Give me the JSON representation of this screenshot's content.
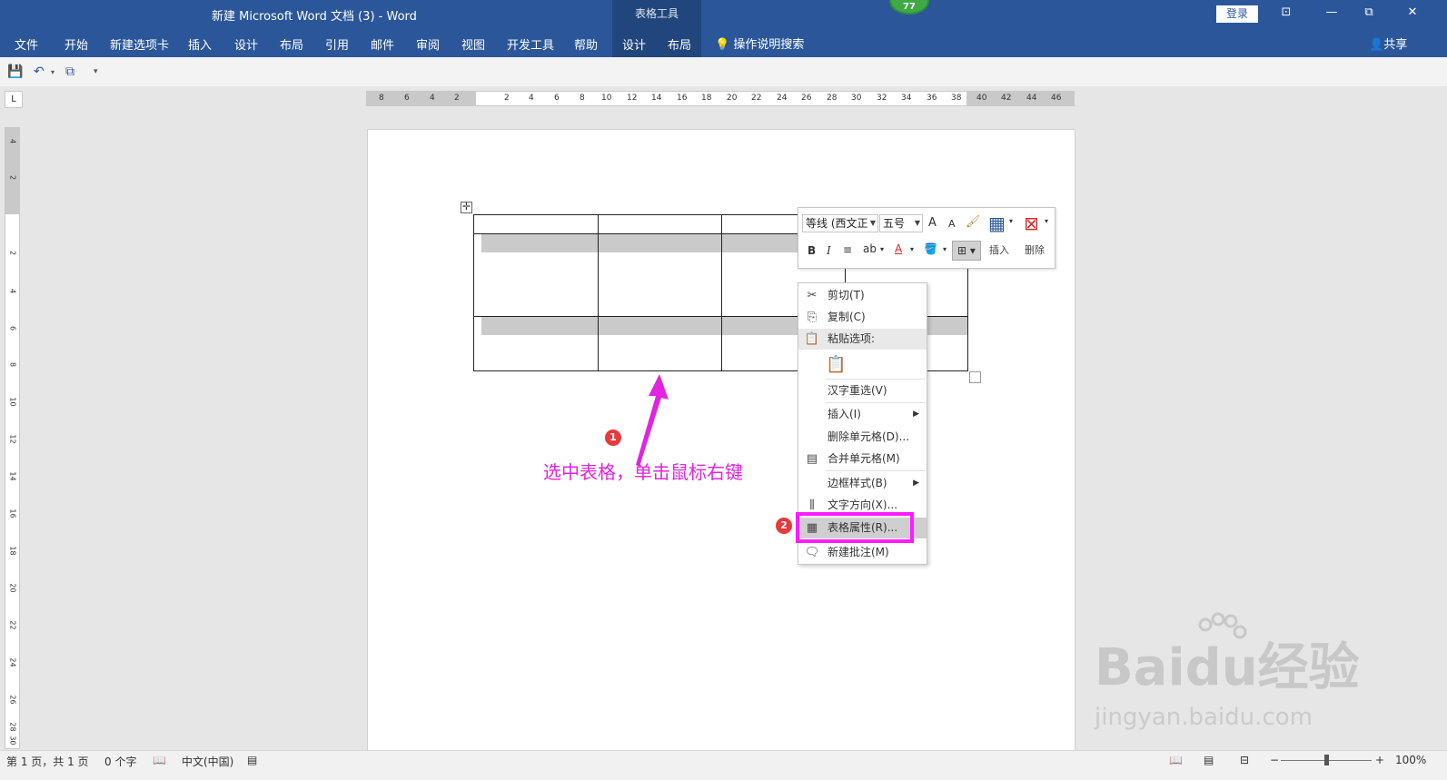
{
  "window": {
    "title": "新建 Microsoft Word 文档 (3)  -  Word",
    "context_tab_group": "表格工具",
    "badge_count": "77",
    "login_label": "登录",
    "win_ribbon_opts": "⊡",
    "win_restore": "⧉",
    "win_close": "✕"
  },
  "ribbon": {
    "tabs": [
      "文件",
      "开始",
      "新建选项卡",
      "插入",
      "设计",
      "布局",
      "引用",
      "邮件",
      "审阅",
      "视图",
      "开发工具",
      "帮助",
      "设计",
      "布局"
    ],
    "tell_me": "操作说明搜索",
    "share": "共享"
  },
  "ruler": {
    "h_ticks": [
      "8",
      "6",
      "4",
      "2",
      "2",
      "4",
      "6",
      "8",
      "10",
      "12",
      "14",
      "16",
      "18",
      "20",
      "22",
      "24",
      "26",
      "28",
      "30",
      "32",
      "34",
      "36",
      "38",
      "40",
      "42",
      "44",
      "46"
    ],
    "v_ticks": [
      "4",
      "2",
      "2",
      "4",
      "6",
      "8",
      "10",
      "12",
      "14",
      "16",
      "18",
      "20",
      "22",
      "24",
      "26",
      "28",
      "30"
    ]
  },
  "annotation": {
    "badge1": "1",
    "badge2": "2",
    "text": "选中表格，单击鼠标右键"
  },
  "mini_toolbar": {
    "font": "等线 (西文正",
    "size": "五号",
    "grow": "A",
    "shrink": "A",
    "bold": "B",
    "italic": "I",
    "font_color": "A",
    "insert": "插入",
    "delete": "删除"
  },
  "context_menu": {
    "cut": "剪切(T)",
    "copy": "复制(C)",
    "paste_options": "粘贴选项:",
    "reconvert": "汉字重选(V)",
    "insert": "插入(I)",
    "delete_cells": "删除单元格(D)...",
    "merge_cells": "合并单元格(M)",
    "border_styles": "边框样式(B)",
    "text_direction": "文字方向(X)...",
    "table_properties": "表格属性(R)...",
    "new_comment": "新建批注(M)"
  },
  "statusbar": {
    "page": "第 1 页，共 1 页",
    "words": "0 个字",
    "language": "中文(中国)",
    "zoom": "100%",
    "zoom_minus": "−",
    "zoom_plus": "+"
  },
  "watermark": {
    "brand": "Baidu经验",
    "url": "jingyan.baidu.com"
  },
  "colors": {
    "ribbon": "#2b579a",
    "annotation": "#e024e0",
    "highlight_box": "#ff1cff",
    "badge": "#e8393c"
  }
}
